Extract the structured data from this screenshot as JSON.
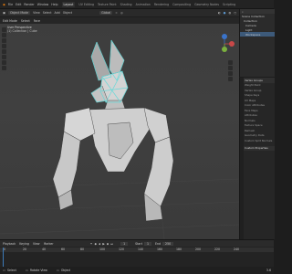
{
  "menu": [
    "File",
    "Edit",
    "Render",
    "Window",
    "Help"
  ],
  "tabs": [
    "Layout",
    "UV Editing",
    "Texture Paint",
    "Shading",
    "Animation",
    "Rendering",
    "Compositing",
    "Geometry Nodes",
    "Scripting"
  ],
  "header": {
    "mode": "Object Mode",
    "view": "View",
    "select": "Select",
    "add": "Add",
    "object": "Object",
    "orientation": "Global",
    "persp": "User Perspective",
    "collection": "(1) Collection | Cube"
  },
  "toolhdr": {
    "mode": "Edit Mode",
    "select": "Select",
    "face": "Face"
  },
  "outliner": {
    "search_placeholder": "",
    "items": [
      "Scene Collection",
      "Collection",
      "Camera",
      "Light",
      "Workspace"
    ]
  },
  "properties": {
    "section": "Vertex Groups",
    "rows": [
      "Weight Paint",
      "Vertex Group",
      "Shape Keys",
      "UV Maps",
      "Color Attributes",
      "Face Maps",
      "Attributes",
      "Normals",
      "Texture Space",
      "Remesh",
      "Geometry Data",
      "Custom Split Normals"
    ],
    "custom": "Custom Properties"
  },
  "timeline": {
    "playback": "Playback",
    "keying": "Keying",
    "view": "View",
    "marker": "Marker",
    "frame": "1",
    "start_label": "Start",
    "start": "1",
    "end_label": "End",
    "end": "250",
    "ticks": [
      "0",
      "20",
      "40",
      "60",
      "80",
      "100",
      "120",
      "140",
      "160",
      "180",
      "200",
      "220",
      "240"
    ]
  },
  "status": {
    "select": "Select",
    "rotate": "Rotate View",
    "menu": "Object",
    "version": "3.6"
  },
  "colors": {
    "accent": "#3d7ab8",
    "wire": "#6ad8d8",
    "mesh": "#c9c9c9"
  }
}
